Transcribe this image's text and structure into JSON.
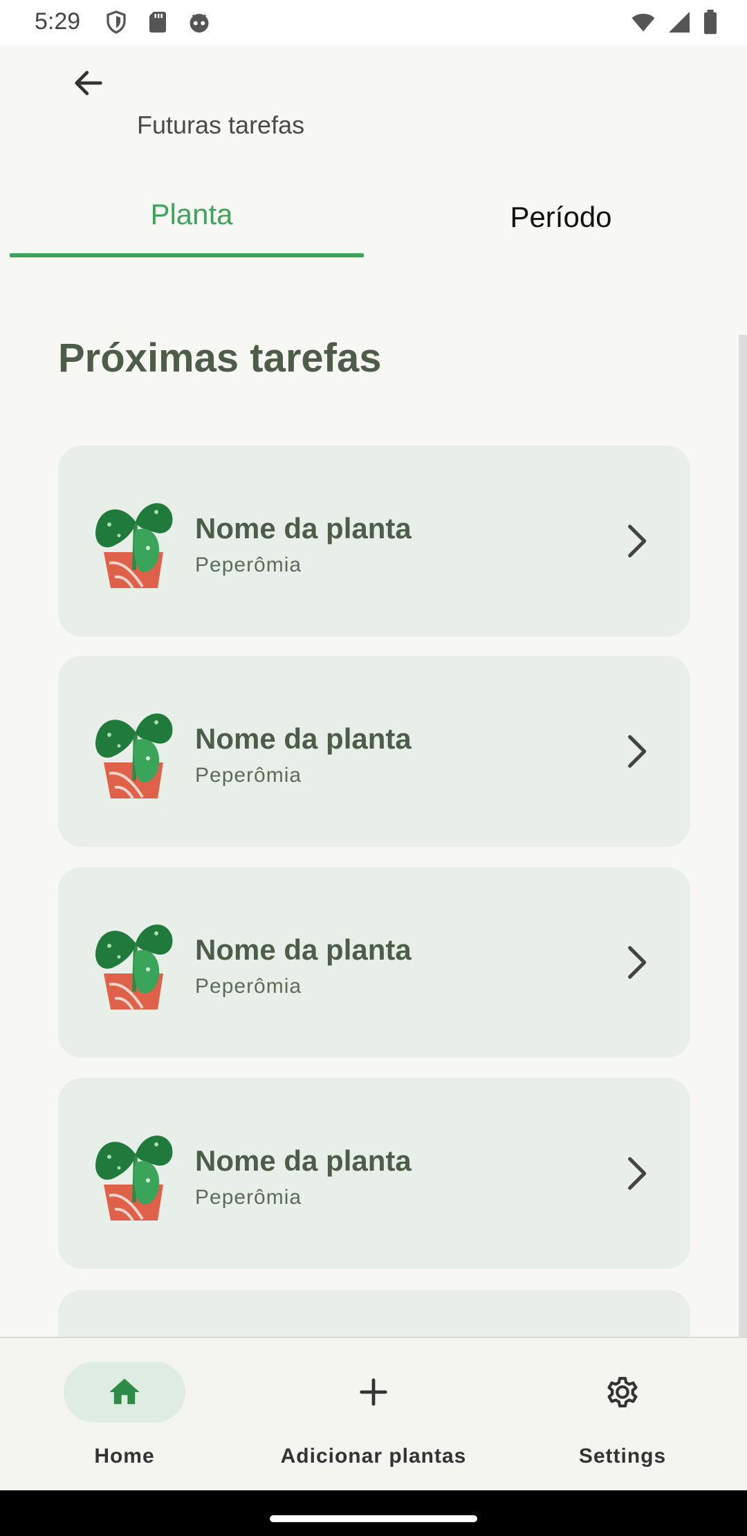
{
  "status_bar": {
    "time": "5:29",
    "left_icons": [
      "shield-icon",
      "sd-card-icon",
      "android-robot-icon"
    ],
    "right_icons": [
      "wifi-icon",
      "signal-icon",
      "battery-icon"
    ]
  },
  "header": {
    "title": "Futuras tarefas"
  },
  "tabs": [
    {
      "label": "Planta",
      "selected": true
    },
    {
      "label": "Período",
      "selected": false
    }
  ],
  "section": {
    "title": "Próximas tarefas"
  },
  "cards": [
    {
      "title": "Nome da planta",
      "subtitle": "Peperômia"
    },
    {
      "title": "Nome da planta",
      "subtitle": "Peperômia"
    },
    {
      "title": "Nome da planta",
      "subtitle": "Peperômia"
    },
    {
      "title": "Nome da planta",
      "subtitle": "Peperômia"
    },
    {
      "title": "",
      "subtitle": ""
    }
  ],
  "bottom_nav": [
    {
      "label": "Home",
      "icon": "home-icon",
      "selected": true
    },
    {
      "label": "Adicionar plantas",
      "icon": "plus-icon",
      "selected": false
    },
    {
      "label": "Settings",
      "icon": "gear-icon",
      "selected": false
    }
  ],
  "colors": {
    "accent": "#3fa45b",
    "heading": "#4d5d4a",
    "card_bg": "#e8efe9",
    "background": "#f7f8f3",
    "pot": "#e0614a",
    "leaf": "#1f7a3c"
  }
}
